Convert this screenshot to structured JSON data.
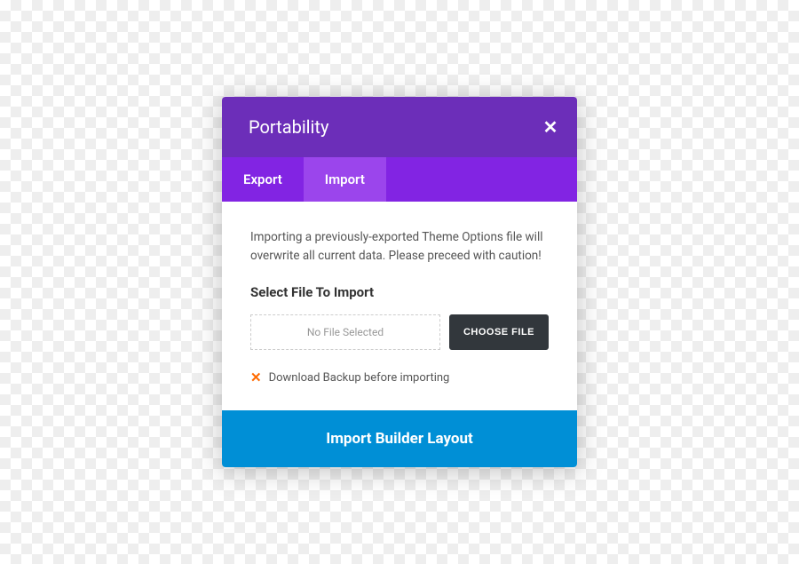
{
  "modal": {
    "title": "Portability",
    "tabs": {
      "export": "Export",
      "import": "Import"
    },
    "description": "Importing a previously-exported Theme Options file will overwrite all current data. Please preceed with caution!",
    "section_label": "Select File To Import",
    "file_placeholder": "No File Selected",
    "choose_file_label": "CHOOSE FILE",
    "backup_label": "Download Backup before importing",
    "footer_button": "Import Builder Layout"
  }
}
